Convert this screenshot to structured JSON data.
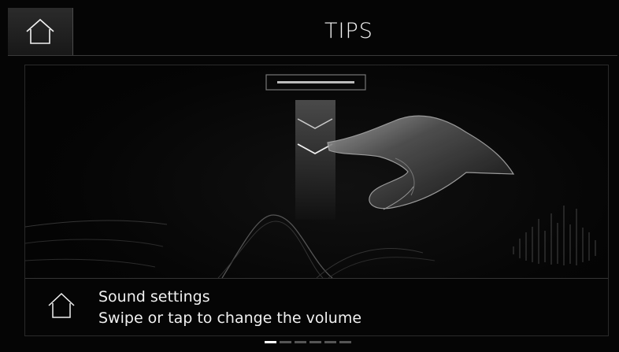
{
  "header": {
    "title": "TIPS",
    "home_icon": "home-icon"
  },
  "tip": {
    "title": "Sound settings",
    "text": "Swipe or tap to change the volume",
    "icon": "home-icon"
  },
  "pager": {
    "total": 6,
    "active": 1
  }
}
